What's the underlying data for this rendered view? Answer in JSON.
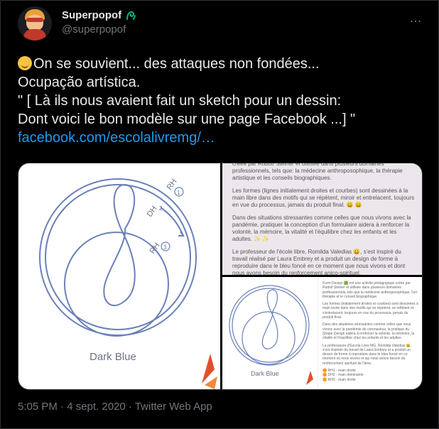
{
  "author": {
    "display_name": "Superpopof",
    "handle": "@superpopof",
    "badge_icon": "spiral-badge-icon"
  },
  "more_icon": "…",
  "tweet": {
    "line1": "On se souvient... des attaques non fondées...",
    "line2": "Ocupação artística.",
    "line3": "\" [ Là ils nous avaient fait un sketch pour un dessin:",
    "line4": "Dont voici le bon modèle sur une page Facebook ...] \"",
    "link": "facebook.com/escolalivremg/…"
  },
  "media": {
    "main_caption": "Dark Blue",
    "labels": {
      "rh1": "RH",
      "rh1_num": "1",
      "dh": "DH",
      "dh_num": "2",
      "rh2": "RH",
      "rh2_num": "3"
    },
    "top_right_paragraphs": [
      "créée par Rudolf Steiner et utilisée dans plusieurs domaines professionnels, tels que: la médecine anthroposophique, la thérapie artistique et les conseils biographiques.",
      "Les formes (lignes initialement droites et courbes) sont dessinées à la main libre dans des motifs qui se répètent, miroir et entrelacent, toujours en vue du processus, jamais du produit final. 😀 😀",
      "Dans des situations stressantes comme celles que nous vivons avec la pandémie, pratiquer la conception d'un formulaire aidera à renforcer la volonté, la mémoire, la vitalité et l'équilibre chez les enfants et les adultes. ✨ ✨",
      "Le professeur de l'école libre, Romilda Valedias 😀, s'est inspiré du travail réalisé par Laura Embrey et a produit un design de forme à reproduire dans le bleu foncé en ce moment que nous vivons et dont nous avons besoin du renforcement anico-spirituel."
    ],
    "bottom_right_caption": "Dark Blue",
    "bottom_right_paragraphs": [
      "Form Design 🟩 est une activité pédagogique créée par Rudolf Steiner et utilisée dans plusieurs domaines professionnels, tels que la médecine anthroposophique, l'art thérapie et le conseil biographique.",
      "Les formes (initialement droites et courbes) sont dessinées à main levée dans des motifs qui se répètent, se reflètent et s'entrelacent, toujours en vue du processus, jamais du produit final.",
      "Dans des situations stressantes comme celles que nous vivons avec la pandémie de coronavirus, la pratique du Shape Design aidera à renforcer la volonté, la mémoire, la vitalité et l'équilibre chez les enfants et les adultes.",
      "La professeure d'Escola Livre MG, Romilda Valedias 😀, s'est inspirée du travail de Laura Embrey et a produit un dessin de forme à reproduire dans le bleu foncé en ce moment où nous vivons et qui nous avons besoin du renforcement spirituel de l'âme.",
      "🟠 RH1 - main droite\n🟠 DH2 - main dominante\n🟠 RH3 - main droite"
    ]
  },
  "footer": {
    "timestamp": "5:05 PM · 4 sept. 2020 · Twitter Web App"
  },
  "colors": {
    "link": "#1d9bf0",
    "muted": "#71767b",
    "badge": "#00ba7c",
    "diagram": "#6a80b8"
  }
}
